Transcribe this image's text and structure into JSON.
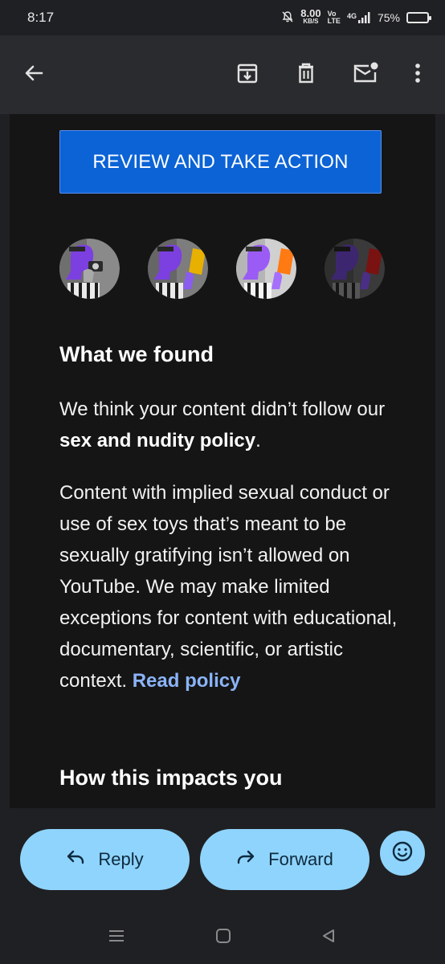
{
  "status_bar": {
    "time": "8:17",
    "net_speed_value": "8.00",
    "net_speed_unit": "KB/S",
    "volte_top": "Vo",
    "volte_bottom": "LTE",
    "network": "4G",
    "battery": "75%",
    "battery_level": 0.75
  },
  "toolbar": {
    "back": "arrow-left-icon",
    "archive": "archive-icon",
    "delete": "trash-icon",
    "mark_unread": "mail-unread-icon",
    "more": "more-vert-icon"
  },
  "email": {
    "cta_label": "REVIEW AND TAKE ACTION",
    "section1_title": "What we found",
    "p1_text": "We think your content didn’t follow our ",
    "p1_bold": "sex and nudity policy",
    "p1_end": ".",
    "p2_text": "Content with implied sexual conduct or use of sex toys that’s meant to be sexually gratifying isn’t allowed on YouTube. We may make limited exceptions for content with educational, documentary, scientific, or artistic context. ",
    "p2_link": "Read policy",
    "section2_title": "How this impacts you"
  },
  "actions": {
    "reply_label": "Reply",
    "forward_label": "Forward",
    "emoji": "emoji-reaction-icon"
  },
  "colors": {
    "cta_blue": "#0b63d6",
    "link_blue": "#8ab4f8",
    "pill_blue": "#8fd4fc",
    "illustration_purple": "#7c3fe0",
    "card_yellow": "#e8b000",
    "card_orange": "#ff7a12",
    "card_red": "#c62828"
  }
}
